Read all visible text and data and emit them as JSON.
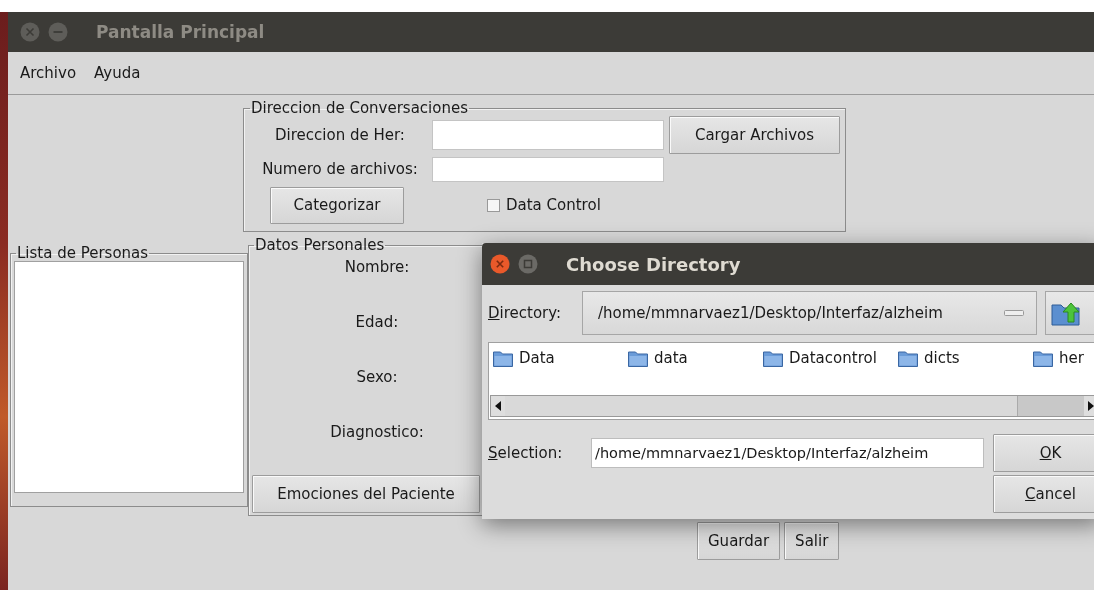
{
  "window": {
    "title": "Pantalla Principal"
  },
  "menu": [
    "Archivo",
    "Ayuda"
  ],
  "conversaciones": {
    "title": "Direccion de Conversaciones",
    "fields": [
      {
        "label": "Direccion de Her:"
      },
      {
        "label": "Numero de archivos:"
      }
    ],
    "load_button": "Cargar Archivos",
    "categorize_button": "Categorizar",
    "checkbox": {
      "label": "Data Control",
      "checked": false
    }
  },
  "personas": {
    "title": "Lista de Personas"
  },
  "datos": {
    "title": "Datos Personales",
    "labels": [
      "Nombre:",
      "Edad:",
      "Sexo:",
      "Diagnostico:"
    ],
    "button": "Emociones del Paciente"
  },
  "buttons": [
    "Guardar",
    "Salir"
  ],
  "dialog": {
    "title": "Choose Directory",
    "directory": {
      "label": "Directory:",
      "underline_first": true,
      "value": "/home/mmnarvaez1/Desktop/Interfaz/alzheim"
    },
    "files": [
      "Data",
      "data",
      "Datacontrol",
      "dicts",
      "her"
    ],
    "selection": {
      "label": "Selection:",
      "underline_first": true,
      "value": "/home/mmnarvaez1/Desktop/Interfaz/alzheim"
    },
    "buttons": [
      {
        "label": "OK",
        "underline_first": true
      },
      {
        "label": "Cancel",
        "underline_first": true
      }
    ]
  }
}
